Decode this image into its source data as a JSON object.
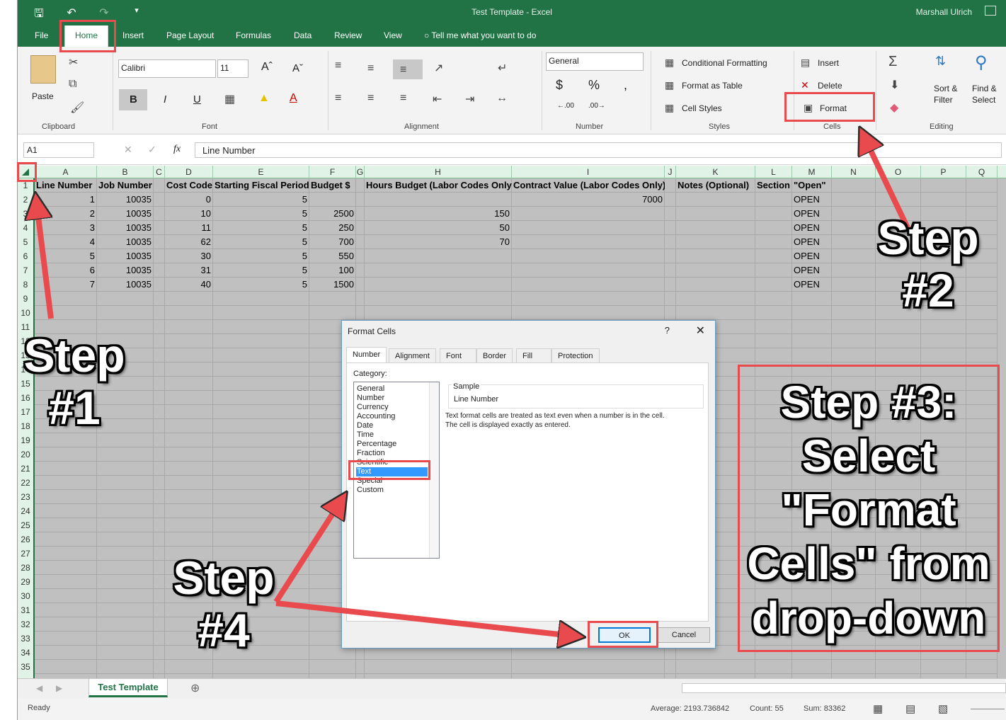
{
  "window": {
    "doc_title": "Test Template  -  Excel",
    "user": "Marshall Ulrich"
  },
  "tabs": [
    "File",
    "Home",
    "Insert",
    "Page Layout",
    "Formulas",
    "Data",
    "Review",
    "View"
  ],
  "tell_me": "Tell me what you want to do",
  "ribbon": {
    "clipboard": {
      "paste": "Paste",
      "label": "Clipboard"
    },
    "font": {
      "name": "Calibri",
      "size": "11",
      "label": "Font",
      "bold": "B",
      "italic": "I",
      "underline": "U"
    },
    "alignment": {
      "label": "Alignment"
    },
    "number": {
      "format": "General",
      "currency": "$",
      "percent": "%",
      "comma": ",",
      "label": "Number"
    },
    "styles": {
      "conditional": "Conditional Formatting",
      "table": "Format as Table",
      "cell_styles": "Cell Styles",
      "label": "Styles"
    },
    "cells": {
      "insert": "Insert",
      "delete": "Delete",
      "format": "Format",
      "label": "Cells"
    },
    "editing": {
      "sort": "Sort &",
      "sort2": "Filter",
      "find": "Find &",
      "find2": "Select",
      "label": "Editing"
    }
  },
  "formula_bar": {
    "name_box": "A1",
    "fx": "fx",
    "content": "Line Number"
  },
  "grid": {
    "columns": [
      "A",
      "B",
      "C",
      "D",
      "E",
      "F",
      "G",
      "H",
      "I",
      "J",
      "K",
      "L",
      "M",
      "N",
      "O",
      "P",
      "Q"
    ],
    "rows": [
      "1",
      "2",
      "3",
      "4",
      "5",
      "6",
      "7",
      "8",
      "9",
      "10",
      "11",
      "12",
      "13",
      "14",
      "15",
      "16",
      "17",
      "18",
      "19",
      "20",
      "21",
      "22",
      "23",
      "24",
      "25",
      "26",
      "27",
      "28",
      "29",
      "30",
      "31",
      "32",
      "33",
      "34",
      "35"
    ],
    "headers": [
      "Line Number",
      "Job Number",
      "Cost Code",
      "Starting Fiscal Period",
      "Budget $",
      "Hours Budget (Labor Codes Only)",
      "Contract Value (Labor Codes Only)",
      "Notes (Optional)",
      "Section",
      "\"Open\""
    ],
    "data": [
      [
        "1",
        "10035",
        "0",
        "5",
        "",
        "",
        "7000",
        "OPEN"
      ],
      [
        "2",
        "10035",
        "10",
        "5",
        "2500",
        "150",
        "",
        "OPEN"
      ],
      [
        "3",
        "10035",
        "11",
        "5",
        "250",
        "50",
        "",
        "OPEN"
      ],
      [
        "4",
        "10035",
        "62",
        "5",
        "700",
        "70",
        "",
        "OPEN"
      ],
      [
        "5",
        "10035",
        "30",
        "5",
        "550",
        "",
        "",
        "OPEN"
      ],
      [
        "6",
        "10035",
        "31",
        "5",
        "100",
        "",
        "",
        "OPEN"
      ],
      [
        "7",
        "10035",
        "40",
        "5",
        "1500",
        "",
        "",
        "OPEN"
      ]
    ]
  },
  "sheet_tab": "Test Template",
  "status": {
    "ready": "Ready",
    "average": "Average: 2193.736842",
    "count": "Count: 55",
    "sum": "Sum: 83362"
  },
  "dialog": {
    "title": "Format Cells",
    "help": "?",
    "tabs": [
      "Number",
      "Alignment",
      "Font",
      "Border",
      "Fill",
      "Protection"
    ],
    "category_label": "Category:",
    "categories": [
      "General",
      "Number",
      "Currency",
      "Accounting",
      "Date",
      "Time",
      "Percentage",
      "Fraction",
      "Scientific",
      "Text",
      "Special",
      "Custom"
    ],
    "selected": "Text",
    "sample_label": "Sample",
    "sample_value": "Line Number",
    "description1": "Text format cells are treated as text even when a number is in the cell.",
    "description2": "The cell is displayed exactly as entered.",
    "ok": "OK",
    "cancel": "Cancel"
  },
  "annotations": {
    "step1a": "Step",
    "step1b": "#1",
    "step2a": "Step",
    "step2b": "#2",
    "step3a": "Step #3:",
    "step3b": "Select",
    "step3c": "\"Format",
    "step3d": "Cells\" from",
    "step3e": "drop-down",
    "step4a": "Step",
    "step4b": "#4",
    "highlight_color": "#e84a4e"
  }
}
